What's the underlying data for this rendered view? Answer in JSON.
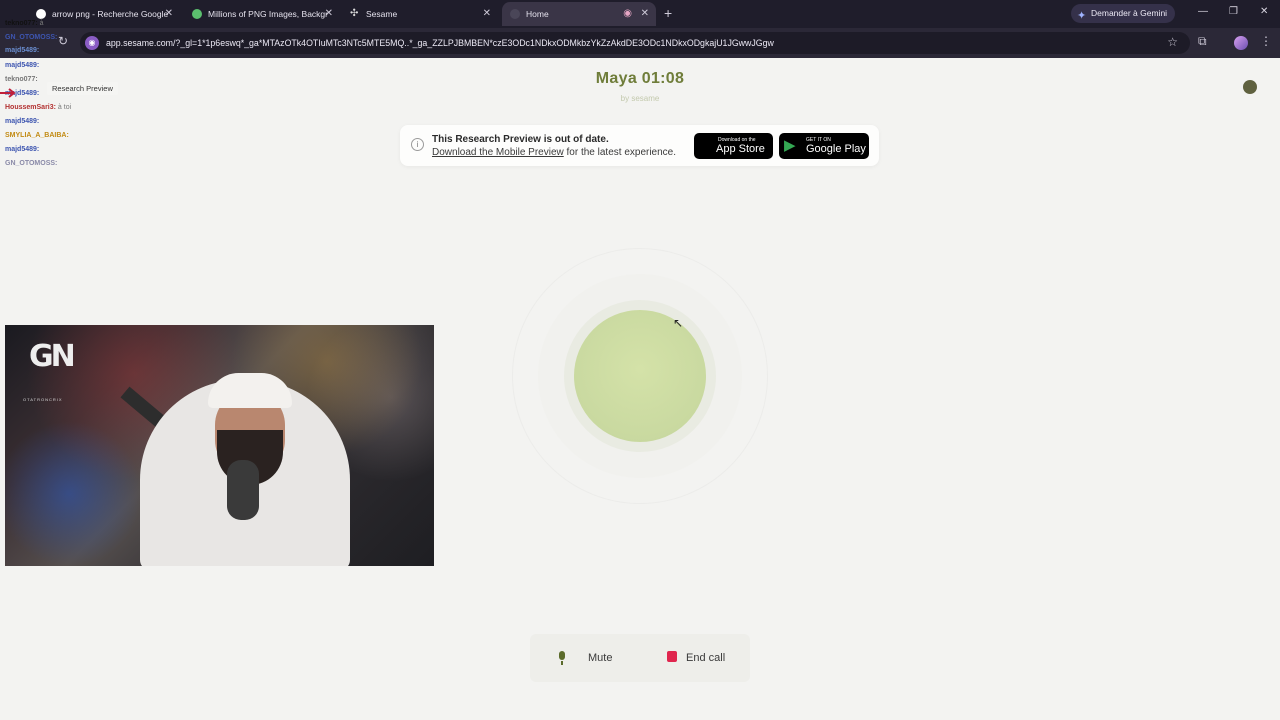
{
  "browser": {
    "tabs": [
      {
        "title": "arrow png - Recherche Google",
        "active": false
      },
      {
        "title": "Millions of PNG Images, Backgr",
        "active": false
      },
      {
        "title": "Sesame",
        "active": false
      },
      {
        "title": "Home",
        "active": true
      }
    ],
    "gemini_label": "Demander à Gemini",
    "url": "app.sesame.com/?_gl=1*1p6eswq*_ga*MTAzOTk4OTIuMTc3NTc5MTE5MQ..*_ga_ZZLPJBMBEN*czE3ODc1NDkxODMkbzYkZzAkdDE3ODc1NDkxODgkajU1JGwwJGgw"
  },
  "header": {
    "title": "Maya 01:08",
    "byline": "by sesame"
  },
  "banner": {
    "title": "This Research Preview is out of date.",
    "link_text": "Download the Mobile Preview",
    "line_suffix": " for the latest experience.",
    "app_store": {
      "small": "Download on the",
      "big": "App Store"
    },
    "google_play": {
      "small": "GET IT ON",
      "big": "Google Play"
    }
  },
  "controls": {
    "mute_label": "Mute",
    "end_label": "End call"
  },
  "overlay": {
    "tooltip": "Research Preview",
    "chat": [
      {
        "user": "tekno077:",
        "msg": "à́"
      },
      {
        "user": "GN_OTOMOSS:",
        "msg": ""
      },
      {
        "user": "majd5489:",
        "msg": ""
      },
      {
        "user": "majd5489:",
        "msg": ""
      },
      {
        "user": "tekno077:",
        "msg": ""
      },
      {
        "user": "majd5489:",
        "msg": ""
      },
      {
        "user": "HoussemSari3:",
        "msg": "à toi"
      },
      {
        "user": "majd5489:",
        "msg": ""
      },
      {
        "user": "SMYLIA_A_BAIBA:",
        "msg": ""
      },
      {
        "user": "majd5489:",
        "msg": ""
      },
      {
        "user": "GN_OTOMOSS:",
        "msg": ""
      }
    ],
    "stream_logo": "GN",
    "stream_logo_sub": "OTATRONCRIX"
  },
  "colors": {
    "accent_title": "#6f7d3a",
    "orb": "#c9d9a0",
    "end_call": "#e0264e",
    "browser_bg": "#1f1d2b"
  }
}
